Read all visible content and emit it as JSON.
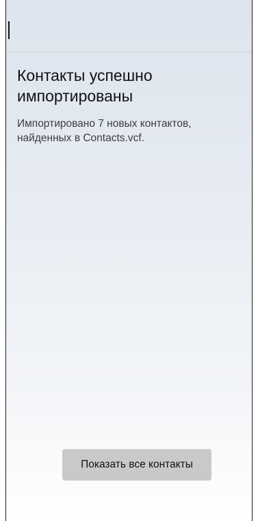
{
  "dialog": {
    "title": "Контакты успешно импортированы",
    "message": "Импортировано 7 новых контактов, найденных в Contacts.vcf."
  },
  "actions": {
    "show_all_label": "Показать все контакты"
  },
  "colors": {
    "background_top": "#dde4ed",
    "background_bottom": "#ffffff",
    "button_bg": "#c9c9c9",
    "text_primary": "#111111",
    "text_secondary": "#3c3c3c"
  }
}
